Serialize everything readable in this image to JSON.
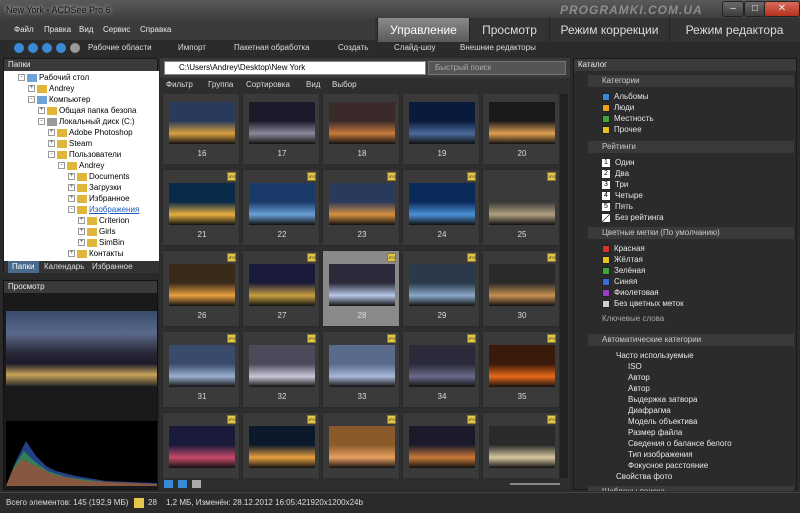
{
  "window": {
    "title": "New York - ACDSee Pro 6",
    "watermark": "PROGRAMKI.COM.UA"
  },
  "menu": [
    "Файл",
    "Правка",
    "Вид",
    "Сервис",
    "Справка"
  ],
  "modes": [
    "Управление",
    "Просмотр",
    "Режим коррекции",
    "Режим редактора"
  ],
  "toolbar": [
    "Рабочие области",
    "Импорт",
    "Пакетная обработка",
    "Создать",
    "Слайд-шоу",
    "Внешние редакторы"
  ],
  "folders_panel": {
    "title": "Папки",
    "tree": [
      "Рабочий стол",
      "Andrey",
      "Компьютер",
      "Общая папка безопа",
      "Локальный диск (C:)",
      "Adobe Photoshop",
      "Steam",
      "Пользователи",
      "Andrey",
      "Documents",
      "Загрузки",
      "Избранное",
      "Изображения",
      "Criterion",
      "Girls",
      "SimBin",
      "Контакты"
    ],
    "tabs": [
      "Папки",
      "Календарь",
      "Избранное"
    ]
  },
  "preview_panel": {
    "title": "Просмотр"
  },
  "path": {
    "value": "C:\\Users\\Andrey\\Desktop\\New York",
    "search_placeholder": "Быстрый поиск"
  },
  "filters": [
    "Фильтр",
    "Группа",
    "Сортировка",
    "Вид",
    "Выбор"
  ],
  "thumbnails": [
    {
      "num": "16",
      "badge": ""
    },
    {
      "num": "17",
      "badge": ""
    },
    {
      "num": "18",
      "badge": ""
    },
    {
      "num": "19",
      "badge": ""
    },
    {
      "num": "20",
      "badge": ""
    },
    {
      "num": "21",
      "badge": "JPG"
    },
    {
      "num": "22",
      "badge": "JPG"
    },
    {
      "num": "23",
      "badge": "JPG"
    },
    {
      "num": "24",
      "badge": "JPG"
    },
    {
      "num": "25",
      "badge": "JPG"
    },
    {
      "num": "26",
      "badge": "JPG"
    },
    {
      "num": "27",
      "badge": "JPG"
    },
    {
      "num": "28",
      "badge": "JPG"
    },
    {
      "num": "29",
      "badge": "JPG"
    },
    {
      "num": "30",
      "badge": "JPG"
    },
    {
      "num": "31",
      "badge": "JPG"
    },
    {
      "num": "32",
      "badge": "JPG"
    },
    {
      "num": "33",
      "badge": "JPG"
    },
    {
      "num": "34",
      "badge": "JPG"
    },
    {
      "num": "35",
      "badge": "JPG"
    },
    {
      "num": "",
      "badge": "JPG"
    },
    {
      "num": "",
      "badge": "JPG"
    },
    {
      "num": "",
      "badge": "JPG"
    },
    {
      "num": "",
      "badge": "JPG"
    },
    {
      "num": "",
      "badge": "JPG"
    }
  ],
  "selected_thumbnail": "28",
  "catalog": {
    "title": "Каталог",
    "categories_header": "Категории",
    "categories": [
      "Альбомы",
      "Люди",
      "Местность",
      "Прочее"
    ],
    "ratings_header": "Рейтинги",
    "ratings": [
      {
        "n": "1",
        "label": "Один"
      },
      {
        "n": "2",
        "label": "Два"
      },
      {
        "n": "3",
        "label": "Три"
      },
      {
        "n": "4",
        "label": "Четыре"
      },
      {
        "n": "5",
        "label": "Пять"
      },
      {
        "n": "",
        "label": "Без рейтинга"
      }
    ],
    "colors_header": "Цветные метки (По умолчанию)",
    "colors": [
      {
        "label": "Красная",
        "color": "#d9322a"
      },
      {
        "label": "Жёлтая",
        "color": "#e8c21c"
      },
      {
        "label": "Зелёная",
        "color": "#3ea83a"
      },
      {
        "label": "Синяя",
        "color": "#3a6ad8"
      },
      {
        "label": "Фиолетовая",
        "color": "#9a3ac8"
      },
      {
        "label": "Без цветных меток",
        "color": "#cfcfcf"
      }
    ],
    "keywords_header": "Ключевые слова",
    "auto_header": "Автоматические категории",
    "auto_sub": "Часто используемые",
    "auto_items": [
      "ISO",
      "Автор",
      "Автор",
      "Выдержка затвора",
      "Диафрагма",
      "Модель объектива",
      "Размер файла",
      "Сведения о балансе белого",
      "Тип изображения",
      "Фокусное расстояние"
    ],
    "auto_footer": "Свойства фото",
    "search_templates": "Шаблоны поиска"
  },
  "status": {
    "total": "Всего элементов: 145  (192,9 МБ)",
    "current": "28",
    "info": "1,2 МБ, Изменён: 28.12.2012 16:05:42",
    "dims": "1920x1200x24b"
  }
}
